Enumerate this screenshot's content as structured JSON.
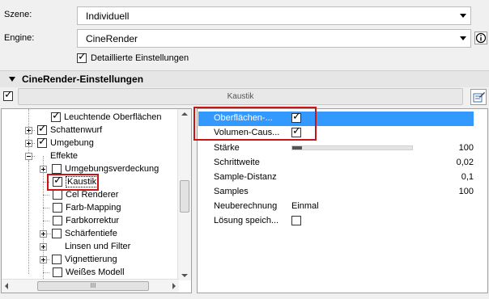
{
  "header": {
    "szene_label": "Szene:",
    "szene_value": "Individuell",
    "engine_label": "Engine:",
    "engine_value": "CineRender",
    "detailed_label": "Detaillierte Einstellungen",
    "detailed_checked": true
  },
  "section": {
    "title": "CineRender-Einstellungen",
    "bar_label": "Kaustik"
  },
  "tree": {
    "items": [
      {
        "label": "Leuchtende Oberflächen",
        "checked": true
      },
      {
        "label": "Schattenwurf",
        "checked": true
      },
      {
        "label": "Umgebung",
        "checked": true
      },
      {
        "label": "Effekte"
      },
      {
        "label": "Umgebungsverdeckung",
        "checked": false
      },
      {
        "label": "Kaustik",
        "checked": true
      },
      {
        "label": "Cel Renderer",
        "checked": false
      },
      {
        "label": "Farb-Mapping",
        "checked": false
      },
      {
        "label": "Farbkorrektur",
        "checked": false
      },
      {
        "label": "Schärfentiefe",
        "checked": false
      },
      {
        "label": "Linsen und Filter"
      },
      {
        "label": "Vignettierung",
        "checked": false
      },
      {
        "label": "Weißes Modell",
        "checked": false
      }
    ],
    "scroll_grip": "III"
  },
  "props": {
    "rows": [
      {
        "name": "Oberflächen-...",
        "checked": true
      },
      {
        "name": "Volumen-Caus...",
        "checked": true
      },
      {
        "name": "Stärke",
        "value": "100",
        "level": 0.08
      },
      {
        "name": "Schrittweite",
        "value": "0,02"
      },
      {
        "name": "Sample-Distanz",
        "value": "0,1"
      },
      {
        "name": "Samples",
        "value": "100"
      },
      {
        "name": "Neuberechnung",
        "value": "Einmal"
      },
      {
        "name": "Lösung speich...",
        "checked": false
      }
    ]
  }
}
